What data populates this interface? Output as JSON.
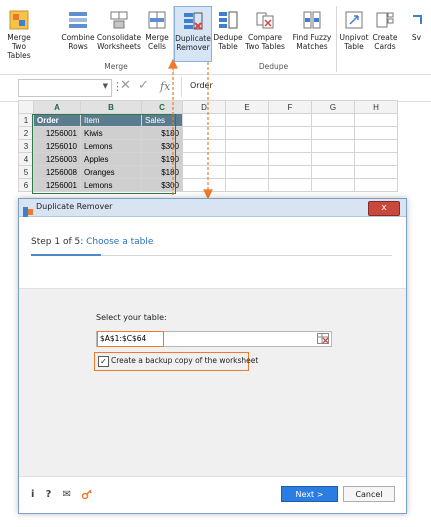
{
  "ribbon": {
    "buttons": [
      {
        "label1": "Merge",
        "label2": "Two Tables"
      },
      {
        "label1": "Combine",
        "label2": "Rows"
      },
      {
        "label1": "Consolidate",
        "label2": "Worksheets"
      },
      {
        "label1": "Merge",
        "label2": "Cells"
      },
      {
        "label1": "Duplicate",
        "label2": "Remover"
      },
      {
        "label1": "Dedupe",
        "label2": "Table"
      },
      {
        "label1": "Compare",
        "label2": "Two Tables"
      },
      {
        "label1": "Find Fuzzy",
        "label2": "Matches"
      },
      {
        "label1": "Unpivot",
        "label2": "Table"
      },
      {
        "label1": "Create",
        "label2": "Cards"
      },
      {
        "label1": "Sv",
        "label2": ""
      }
    ],
    "groups": {
      "merge": "Merge",
      "dedupe": "Dedupe"
    }
  },
  "formula_bar": {
    "fx": "fx",
    "value": "Order"
  },
  "sheet": {
    "columns": [
      "A",
      "B",
      "C",
      "D",
      "E",
      "F",
      "G",
      "H"
    ],
    "header": [
      "Order",
      "Item",
      "Sales"
    ],
    "rows": [
      {
        "n": "1"
      },
      {
        "n": "2",
        "order": "1256001",
        "item": "Kiwis",
        "sales": "$180"
      },
      {
        "n": "3",
        "order": "1256010",
        "item": "Lemons",
        "sales": "$300"
      },
      {
        "n": "4",
        "order": "1256003",
        "item": "Apples",
        "sales": "$190"
      },
      {
        "n": "5",
        "order": "1256008",
        "item": "Oranges",
        "sales": "$180"
      },
      {
        "n": "6",
        "order": "1256001",
        "item": "Lemons",
        "sales": "$300"
      }
    ]
  },
  "dialog": {
    "title": "Duplicate Remover",
    "close": "x",
    "step_prefix": "Step 1 of 5: ",
    "step_name": "Choose a table",
    "select_label": "Select your table:",
    "range": "$A$1:$C$64",
    "backup_label": "Create a backup copy of the worksheet",
    "backup_checked": "✓",
    "next": "Next >",
    "cancel": "Cancel",
    "footer_icons": {
      "info": "i",
      "help": "?",
      "mail": "✉",
      "key": "🔑"
    }
  },
  "colors": {
    "accent": "#ef7a2d",
    "primary": "#2b7de1",
    "header_fill": "#5b7b8f"
  }
}
